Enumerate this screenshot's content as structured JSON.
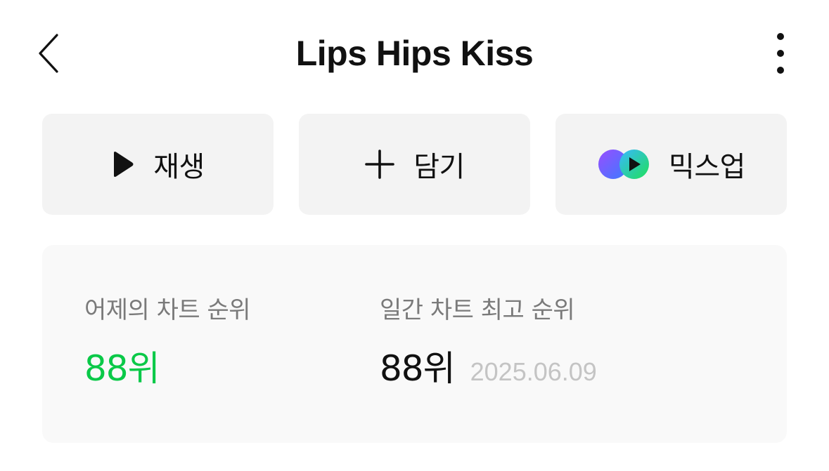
{
  "header": {
    "title": "Lips Hips Kiss",
    "back_icon": "chevron-left-icon",
    "more_icon": "more-vertical-icon"
  },
  "actions": {
    "play": {
      "label": "재생",
      "icon": "play-icon"
    },
    "add": {
      "label": "담기",
      "icon": "plus-icon"
    },
    "mixup": {
      "label": "믹스업",
      "icon": "mixup-logo-icon"
    }
  },
  "chart_rank": {
    "yesterday": {
      "label": "어제의 차트 순위",
      "value": "88위"
    },
    "daily_peak": {
      "label": "일간 차트 최고 순위",
      "value": "88위",
      "date": "2025.06.09"
    }
  },
  "colors": {
    "accent_green": "#0ac948",
    "button_bg": "#f3f3f3",
    "card_bg": "#f9f9f9",
    "label_gray": "#7a7a7a",
    "date_gray": "#c4c4c4",
    "mixup_purple": "#8b4dff",
    "mixup_blue": "#3aa0ff",
    "mixup_green": "#20d65a"
  }
}
